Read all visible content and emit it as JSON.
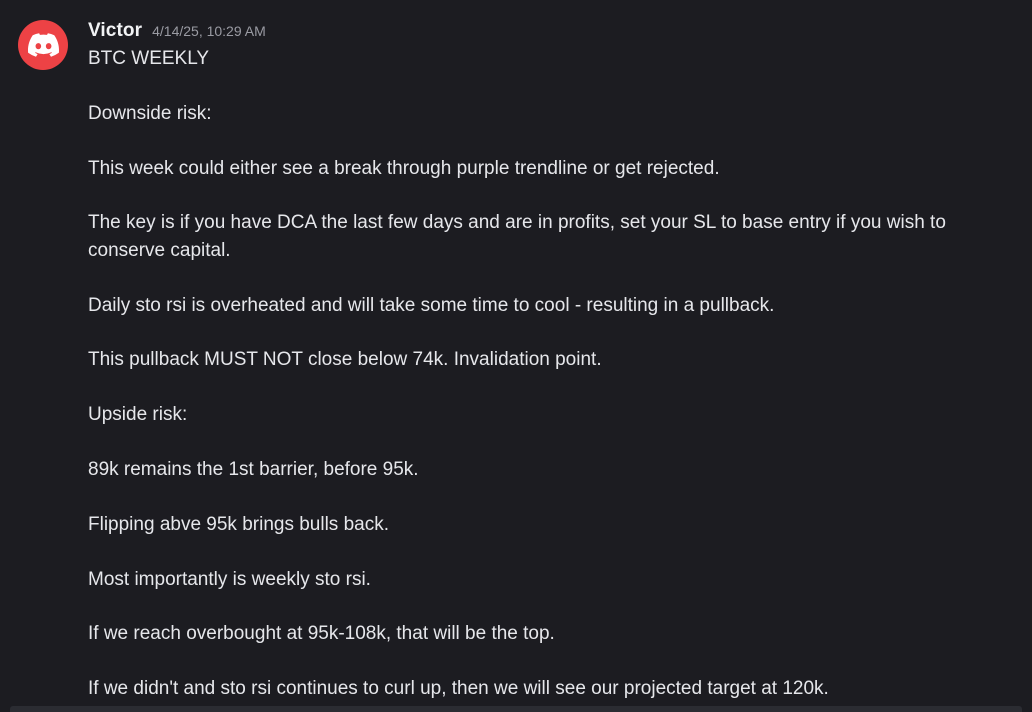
{
  "message": {
    "avatar_icon": "discord-logo-icon",
    "avatar_color": "#ed4245",
    "author": "Victor",
    "timestamp": "4/14/25, 10:29 AM",
    "lines": [
      "BTC WEEKLY",
      "",
      "Downside risk:",
      "",
      "This week could either see a break through purple trendline or get rejected.",
      "",
      "The key is if you have DCA the last few days and are in profits, set your SL to base entry if you wish to",
      "conserve capital.",
      "",
      "Daily sto rsi is overheated and will take some time to cool - resulting in a pullback.",
      "",
      "This pullback MUST NOT close below 74k. Invalidation point.",
      "",
      "Upside risk:",
      "",
      "89k remains the 1st barrier, before 95k.",
      "",
      "Flipping abve 95k brings bulls back.",
      "",
      "Most importantly is weekly sto rsi.",
      "",
      "If we reach overbought at 95k-108k, that will be the top.",
      "",
      "If we didn't and sto rsi continues to curl up, then we will see our projected target at 120k."
    ]
  },
  "colors": {
    "background": "#1c1c21",
    "text": "#e6e7eb",
    "username": "#f2f3f5",
    "timestamp": "#9a9ba3"
  }
}
